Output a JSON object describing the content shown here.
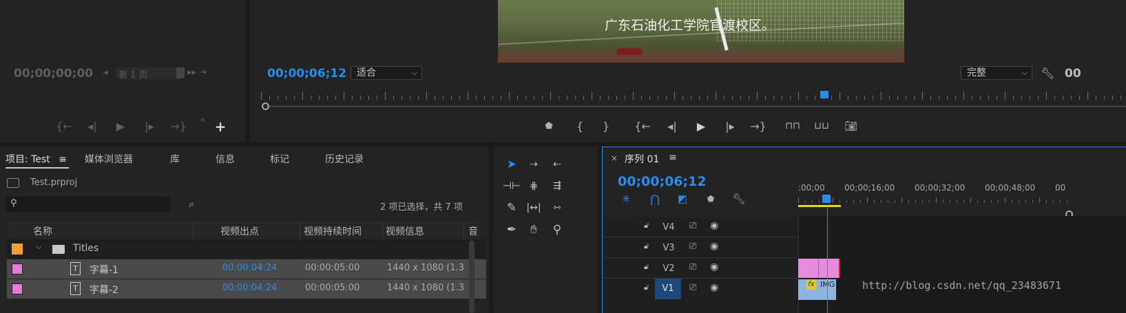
{
  "source_monitor": {
    "timecode": "00;00;00;00",
    "page_label": "第 1 页"
  },
  "program_monitor": {
    "subtitle": "广东石油化工学院官渡校区。",
    "timecode": "00;00;06;12",
    "fit_select": "适合",
    "quality_select": "完整",
    "right_timecode": "00"
  },
  "project_panel": {
    "tabs": [
      "项目: Test",
      "媒体浏览器",
      "库",
      "信息",
      "标记",
      "历史记录"
    ],
    "project_file": "Test.prproj",
    "search_placeholder": "",
    "selection_info": "2 项已选择，共 7 项",
    "columns": [
      "名称",
      "视频出点",
      "视频持续时间",
      "视频信息",
      "音"
    ],
    "rows": [
      {
        "type": "folder",
        "name": "Titles",
        "color": "#f0a030",
        "out": "",
        "duration": "",
        "info": ""
      },
      {
        "type": "title",
        "name": "字幕-1",
        "color": "#e67ad8",
        "out": "00:00:04:24",
        "duration": "00:00:05:00",
        "info": "1440 x 1080 (1.3"
      },
      {
        "type": "title",
        "name": "字幕-2",
        "color": "#e67ad8",
        "out": "00:00:04:24",
        "duration": "00:00:05:00",
        "info": "1440 x 1080 (1.3"
      }
    ]
  },
  "sequence_panel": {
    "tab_title": "序列 01",
    "timecode": "00;00;06;12",
    "ruler_labels": [
      ":00;00",
      "00;00;16;00",
      "00;00;32;00",
      "00;00;48;00",
      "00"
    ],
    "tracks": [
      {
        "name": "V4",
        "active": false
      },
      {
        "name": "V3",
        "active": false
      },
      {
        "name": "V2",
        "active": false
      },
      {
        "name": "V1",
        "active": true
      }
    ],
    "clip_v1_label": "IMG",
    "fx_label": "fx",
    "playhead_fraction": 0.134
  },
  "watermark": "http://blog.csdn.net/qq_23483671",
  "colors": {
    "accent_blue": "#2d8ceb",
    "title_clip": "#e68ae0",
    "video_clip": "#8eb4e0",
    "folder_orange": "#f0a030",
    "in_out_bar": "#e8d520"
  }
}
